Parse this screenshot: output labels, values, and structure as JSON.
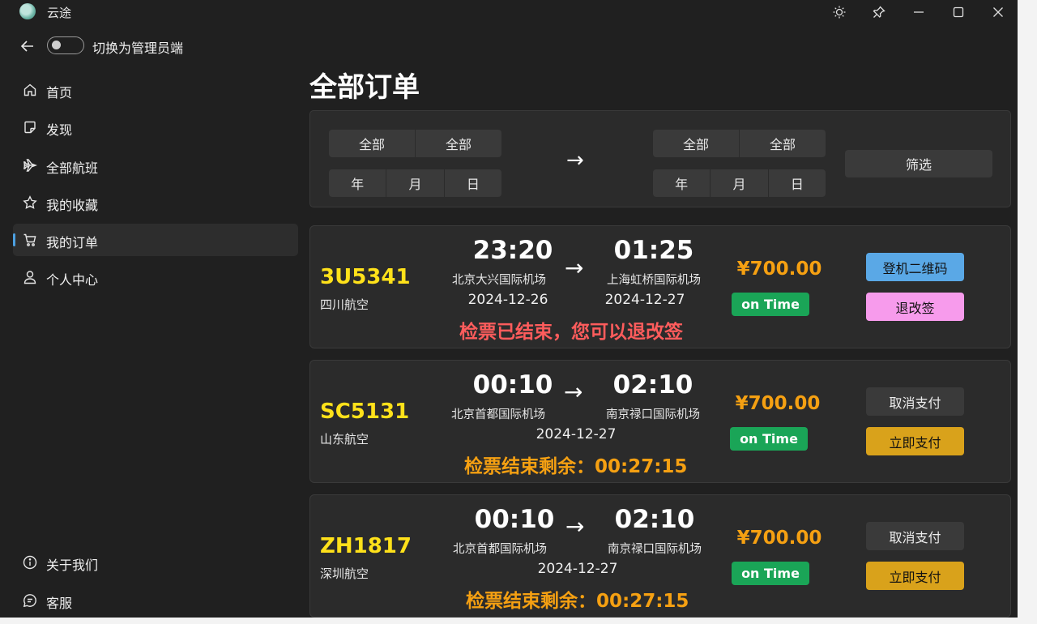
{
  "app": {
    "title": "云途"
  },
  "topbar": {
    "toggle_label": "切换为管理员端"
  },
  "nav": {
    "items": [
      {
        "label": "首页",
        "icon": "home-icon"
      },
      {
        "label": "发现",
        "icon": "note-icon"
      },
      {
        "label": "全部航班",
        "icon": "airplane-icon"
      },
      {
        "label": "我的收藏",
        "icon": "star-icon"
      },
      {
        "label": "我的订单",
        "icon": "cart-icon",
        "active": true
      },
      {
        "label": "个人中心",
        "icon": "person-icon"
      }
    ],
    "footer_items": [
      {
        "label": "关于我们",
        "icon": "info-icon"
      },
      {
        "label": "客服",
        "icon": "chat-icon"
      }
    ]
  },
  "page": {
    "title": "全部订单"
  },
  "filter": {
    "from": {
      "place_a": "全部",
      "place_b": "全部",
      "year": "年",
      "month": "月",
      "day": "日"
    },
    "arrow": "→",
    "to": {
      "place_a": "全部",
      "place_b": "全部",
      "year": "年",
      "month": "月",
      "day": "日"
    },
    "button": "筛选"
  },
  "orders": [
    {
      "flight_no": "3U5341",
      "airline": "四川航空",
      "dep_time": "23:20",
      "arr_time": "01:25",
      "dep_airport": "北京大兴国际机场",
      "arr_airport": "上海虹桥国际机场",
      "dep_date": "2024-12-26",
      "arr_date": "2024-12-27",
      "arrow": "→",
      "notice": "检票已结束，您可以退改签",
      "notice_color": "#ff5c5c",
      "price": "¥700.00",
      "status": "on Time",
      "btn1": {
        "label": "登机二维码",
        "bg": "#5aa8e6",
        "color": "#111111"
      },
      "btn2": {
        "label": "退改签",
        "bg": "#f79bec",
        "color": "#111111"
      }
    },
    {
      "flight_no": "SC5131",
      "airline": "山东航空",
      "dep_time": "00:10",
      "arr_time": "02:10",
      "dep_airport": "北京首都国际机场",
      "arr_airport": "南京禄口国际机场",
      "date": "2024-12-27",
      "arrow": "→",
      "notice": "检票结束剩余：00:27:15",
      "notice_color": "#f5a012",
      "price": "¥700.00",
      "status": "on Time",
      "btn1": {
        "label": "取消支付",
        "bg": "#3a3a3a",
        "color": "#eeeeee"
      },
      "btn2": {
        "label": "立即支付",
        "bg": "#d9a21b",
        "color": "#111111"
      }
    },
    {
      "flight_no": "ZH1817",
      "airline": "深圳航空",
      "dep_time": "00:10",
      "arr_time": "02:10",
      "dep_airport": "北京首都国际机场",
      "arr_airport": "南京禄口国际机场",
      "date": "2024-12-27",
      "arrow": "→",
      "notice": "检票结束剩余：00:27:15",
      "notice_color": "#f5a012",
      "price": "¥700.00",
      "status": "on Time",
      "btn1": {
        "label": "取消支付",
        "bg": "#3a3a3a",
        "color": "#eeeeee"
      },
      "btn2": {
        "label": "立即支付",
        "bg": "#d9a21b",
        "color": "#111111"
      }
    }
  ]
}
